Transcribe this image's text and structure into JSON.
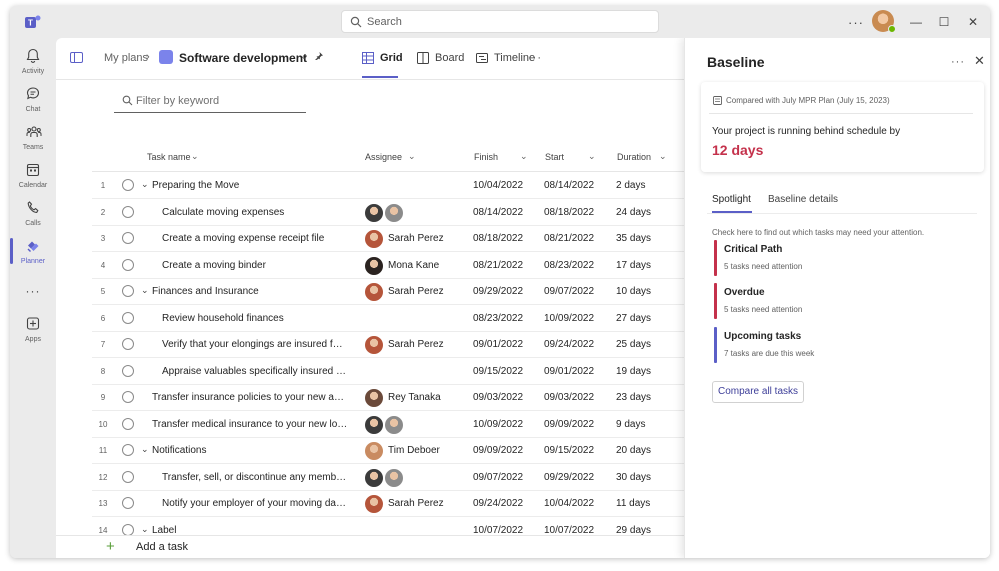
{
  "titlebar": {
    "search_placeholder": "Search",
    "more": "···",
    "window_minimize": "—",
    "window_maximize": "☐",
    "window_close": "✕"
  },
  "rail": {
    "items": [
      {
        "label": "Activity",
        "icon": "bell-icon"
      },
      {
        "label": "Chat",
        "icon": "chat-icon"
      },
      {
        "label": "Teams",
        "icon": "teams-icon"
      },
      {
        "label": "Calendar",
        "icon": "calendar-icon"
      },
      {
        "label": "Calls",
        "icon": "phone-icon"
      },
      {
        "label": "Planner",
        "icon": "planner-icon",
        "active": true
      },
      {
        "label": "···",
        "icon": "more-icon"
      },
      {
        "label": "Apps",
        "icon": "apps-icon"
      }
    ]
  },
  "header": {
    "breadcrumb": "My plans",
    "breadcrumb_sep": "›",
    "plan_title": "Software development",
    "plan_chevron": "⌄",
    "pin": "📌",
    "tabs": [
      "Grid",
      "Board",
      "Timeline"
    ],
    "more": "···"
  },
  "filter": {
    "placeholder": "Filter by keyword"
  },
  "columns": {
    "task_name": "Task name",
    "assignee": "Assignee",
    "finish": "Finish",
    "start": "Start",
    "duration": "Duration",
    "chev": "⌄"
  },
  "rows": [
    {
      "num": "1",
      "name": "Preparing the Move",
      "kind": "group",
      "assignee": "",
      "avatars": [],
      "finish": "10/04/2022",
      "start": "08/14/2022",
      "duration": "2 days"
    },
    {
      "num": "2",
      "name": "Calculate moving expenses",
      "kind": "child",
      "assignee": "",
      "avatars": [
        "#3b3b3b",
        "#8b8b8b"
      ],
      "finish": "08/14/2022",
      "start": "08/18/2022",
      "duration": "24 days"
    },
    {
      "num": "3",
      "name": "Create a moving expense receipt file",
      "kind": "child",
      "assignee": "Sarah Perez",
      "avatars": [
        "#b5553a"
      ],
      "finish": "08/18/2022",
      "start": "08/21/2022",
      "duration": "35 days"
    },
    {
      "num": "4",
      "name": "Create a moving binder",
      "kind": "child",
      "assignee": "Mona Kane",
      "avatars": [
        "#2b2320"
      ],
      "finish": "08/21/2022",
      "start": "08/23/2022",
      "duration": "17 days"
    },
    {
      "num": "5",
      "name": "Finances and Insurance",
      "kind": "group",
      "assignee": "Sarah Perez",
      "avatars": [
        "#b5553a"
      ],
      "finish": "09/29/2022",
      "start": "09/07/2022",
      "duration": "10 days"
    },
    {
      "num": "6",
      "name": "Review household finances",
      "kind": "child",
      "assignee": "",
      "avatars": [],
      "finish": "08/23/2022",
      "start": "10/09/2022",
      "duration": "27 days"
    },
    {
      "num": "7",
      "name": "Verify that your elongings are insured for t...",
      "kind": "child",
      "assignee": "Sarah Perez",
      "avatars": [
        "#b5553a"
      ],
      "finish": "09/01/2022",
      "start": "09/24/2022",
      "duration": "25 days"
    },
    {
      "num": "8",
      "name": "Appraise valuables specifically insured for...",
      "kind": "child",
      "assignee": "",
      "avatars": [],
      "finish": "09/15/2022",
      "start": "09/01/2022",
      "duration": "19 days"
    },
    {
      "num": "9",
      "name": "Transfer insurance policies to your new addr...",
      "kind": "top",
      "assignee": "Rey Tanaka",
      "avatars": [
        "#6b4a3a"
      ],
      "finish": "09/03/2022",
      "start": "09/03/2022",
      "duration": "23 days"
    },
    {
      "num": "10",
      "name": "Transfer medical insurance to your new locati...",
      "kind": "top",
      "assignee": "",
      "avatars": [
        "#3b3b3b",
        "#8b8b8b"
      ],
      "finish": "10/09/2022",
      "start": "09/09/2022",
      "duration": "9 days"
    },
    {
      "num": "11",
      "name": "Notifications",
      "kind": "group",
      "assignee": "Tim Deboer",
      "avatars": [
        "#c98b61"
      ],
      "finish": "09/09/2022",
      "start": "09/15/2022",
      "duration": "20 days"
    },
    {
      "num": "12",
      "name": "Transfer, sell, or discontinue any members...",
      "kind": "child",
      "assignee": "",
      "avatars": [
        "#3b3b3b",
        "#8b8b8b"
      ],
      "finish": "09/07/2022",
      "start": "09/29/2022",
      "duration": "30 days"
    },
    {
      "num": "13",
      "name": "Notify your employer of your moving date...",
      "kind": "child",
      "assignee": "Sarah Perez",
      "avatars": [
        "#b5553a"
      ],
      "finish": "09/24/2022",
      "start": "10/04/2022",
      "duration": "11 days"
    },
    {
      "num": "14",
      "name": "Label",
      "kind": "group",
      "assignee": "",
      "avatars": [],
      "finish": "10/07/2022",
      "start": "10/07/2022",
      "duration": "29 days"
    }
  ],
  "add_task": {
    "plus": "+",
    "label": "Add a task"
  },
  "panel": {
    "title": "Baseline",
    "more": "···",
    "close": "✕",
    "compared": "Compared with July MPR Plan (July 15, 2023)",
    "behind": "Your project is running behind schedule by",
    "days": "12 days",
    "tabs": [
      "Spotlight",
      "Baseline details"
    ],
    "hint": "Check here to find out which tasks may need your attention.",
    "spotlight": [
      {
        "title": "Critical Path",
        "sub": "5 tasks need attention",
        "color": "#c4314b"
      },
      {
        "title": "Overdue",
        "sub": "5 tasks need attention",
        "color": "#c4314b"
      },
      {
        "title": "Upcoming tasks",
        "sub": "7 tasks are due this week",
        "color": "#5b5fc7"
      }
    ],
    "compare_button": "Compare all tasks"
  },
  "colors": {
    "accent": "#5b5fc7",
    "alert": "#c4314b",
    "success": "#6bb700"
  }
}
